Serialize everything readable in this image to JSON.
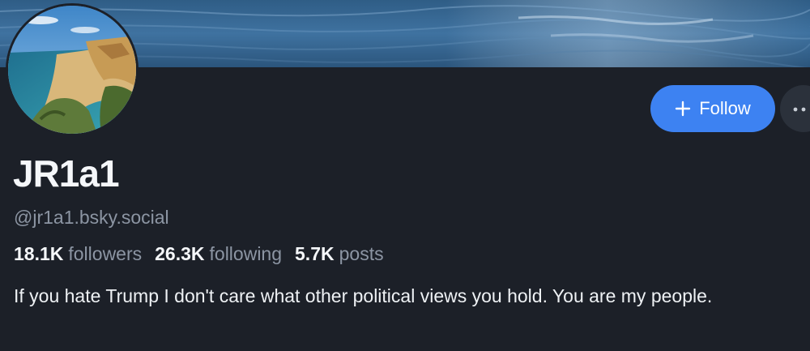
{
  "profile": {
    "display_name": "JR1a1",
    "handle": "@jr1a1.bsky.social",
    "bio": "If you hate Trump I don't care what other political views you hold. You are my people."
  },
  "stats": [
    {
      "count": "18.1K",
      "label": "followers"
    },
    {
      "count": "26.3K",
      "label": "following"
    },
    {
      "count": "5.7K",
      "label": "posts"
    }
  ],
  "actions": {
    "follow_label": "Follow"
  },
  "colors": {
    "background": "#1c2028",
    "accent": "#3d82f2",
    "muted_text": "#8c95a3"
  },
  "icons": {
    "follow": "plus-icon",
    "more": "ellipsis-icon"
  }
}
